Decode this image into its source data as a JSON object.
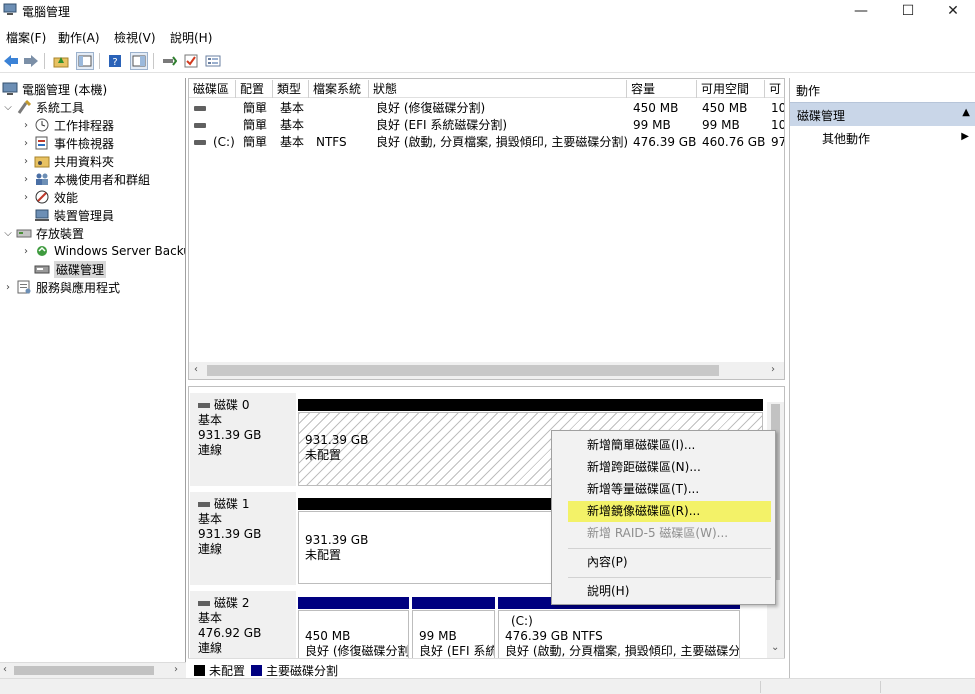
{
  "window": {
    "title": "電腦管理",
    "minimize": "—",
    "maximize": "☐",
    "close": "✕"
  },
  "menu": [
    "檔案(F)",
    "動作(A)",
    "檢視(V)",
    "說明(H)"
  ],
  "tree": {
    "root": "電腦管理 (本機)",
    "system_tools": "系統工具",
    "task_scheduler": "工作排程器",
    "event_viewer": "事件檢視器",
    "shared_folders": "共用資料夾",
    "local_users": "本機使用者和群組",
    "performance": "效能",
    "device_manager": "裝置管理員",
    "storage": "存放裝置",
    "windows_backup": "Windows Server Backup",
    "disk_mgmt": "磁碟管理",
    "services": "服務與應用程式"
  },
  "volumes": {
    "headers": [
      "磁碟區",
      "配置",
      "類型",
      "檔案系統",
      "狀態",
      "容量",
      "可用空間",
      "可"
    ],
    "rows": [
      [
        "",
        "簡單",
        "基本",
        "",
        "良好 (修復磁碟分割)",
        "450 MB",
        "450 MB",
        "10"
      ],
      [
        "",
        "簡單",
        "基本",
        "",
        "良好 (EFI 系統磁碟分割)",
        "99 MB",
        "99 MB",
        "10"
      ],
      [
        "(C:)",
        "簡單",
        "基本",
        "NTFS",
        "良好 (啟動, 分頁檔案, 損毀傾印, 主要磁碟分割)",
        "476.39 GB",
        "460.76 GB",
        "97"
      ]
    ]
  },
  "disks": [
    {
      "name": "磁碟 0",
      "type": "基本",
      "size": "931.39 GB",
      "status": "連線",
      "part_size": "931.39 GB",
      "part_state": "未配置"
    },
    {
      "name": "磁碟 1",
      "type": "基本",
      "size": "931.39 GB",
      "status": "連線",
      "part_size": "931.39 GB",
      "part_state": "未配置"
    },
    {
      "name": "磁碟 2",
      "type": "基本",
      "size": "476.92 GB",
      "status": "連線",
      "parts": [
        {
          "size": "450 MB",
          "state": "良好 (修復磁碟分割)"
        },
        {
          "size": "99 MB",
          "state": "良好 (EFI 系統磁碟分割)"
        },
        {
          "name": "(C:)",
          "size": "476.39 GB NTFS",
          "state": "良好 (啟動, 分頁檔案, 損毀傾印, 主要磁碟分割)"
        }
      ]
    }
  ],
  "legend": {
    "unallocated": "未配置",
    "primary": "主要磁碟分割",
    "unallocated_color": "#000000",
    "primary_color": "#000080"
  },
  "actions": {
    "title": "動作",
    "section": "磁碟管理",
    "more": "其他動作"
  },
  "context_menu": {
    "items": [
      "新增簡單磁碟區(I)...",
      "新增跨距磁碟區(N)...",
      "新增等量磁碟區(T)...",
      "新增鏡像磁碟區(R)...",
      "新增 RAID-5 磁碟區(W)...",
      "內容(P)",
      "說明(H)"
    ],
    "highlight_color": "#f3f268"
  }
}
